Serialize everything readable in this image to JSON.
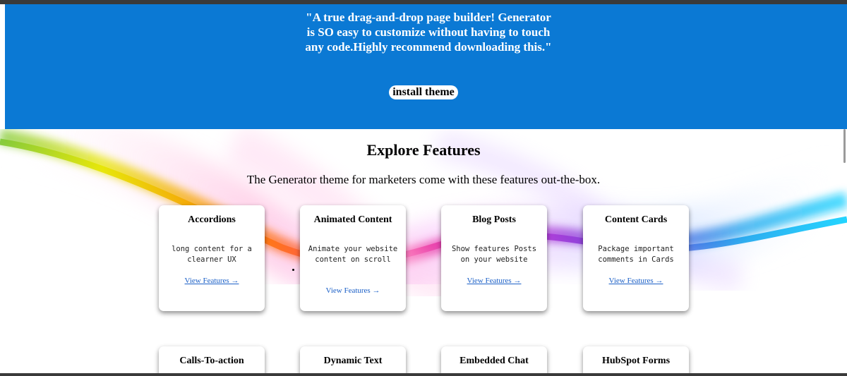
{
  "hero": {
    "quote": "\"A true drag-and-drop page builder! Generator is SO easy to customize without having to touch any code.Highly recommend downloading this.\"",
    "install_label": "install theme"
  },
  "features": {
    "title": "Explore Features",
    "subtitle": "The Generator theme for marketers come with these features out-the-box.",
    "cards": [
      {
        "title": "Accordions",
        "description": "long content for a clearner UX",
        "link": "View Features →"
      },
      {
        "title": "Animated Content",
        "description": "Animate your website content on scroll",
        "link": "View Features →"
      },
      {
        "title": "Blog Posts",
        "description": "Show features Posts on your website",
        "link": "View Features →"
      },
      {
        "title": "Content Cards",
        "description": "Package important comments in Cards",
        "link": "View Features →"
      },
      {
        "title": "Calls-To-action"
      },
      {
        "title": "Dynamic Text"
      },
      {
        "title": "Embedded Chat"
      },
      {
        "title": "HubSpot Forms"
      }
    ]
  },
  "colors": {
    "hero_bg": "#0b79d4",
    "link": "#1a5fc7"
  }
}
